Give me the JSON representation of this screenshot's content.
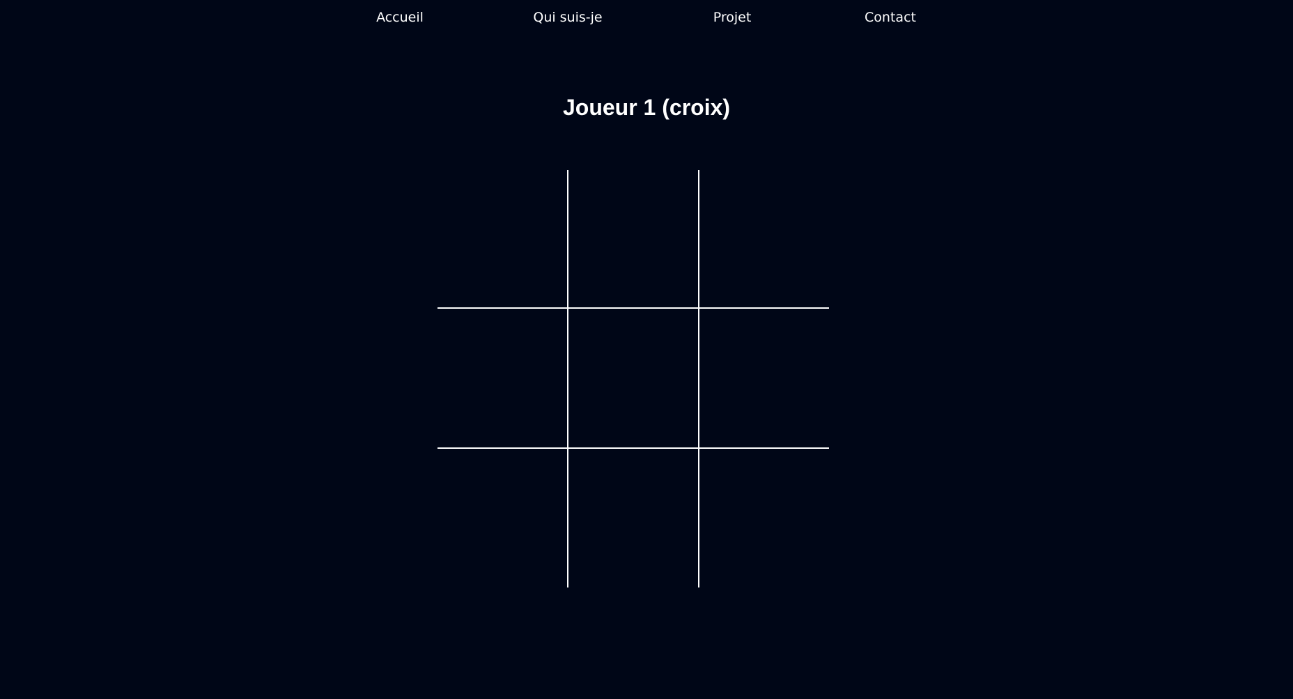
{
  "nav": {
    "items": [
      {
        "label": "Accueil"
      },
      {
        "label": "Qui suis-je"
      },
      {
        "label": "Projet"
      },
      {
        "label": "Contact"
      }
    ]
  },
  "game": {
    "turn_label": "Joueur 1 (croix)",
    "board": [
      "",
      "",
      "",
      "",
      "",
      "",
      "",
      "",
      ""
    ]
  },
  "colors": {
    "background": "#000617",
    "foreground": "#ffffff"
  }
}
